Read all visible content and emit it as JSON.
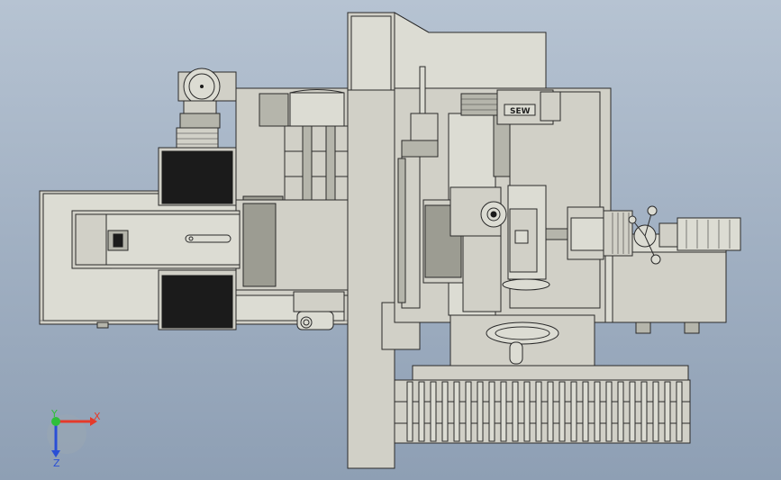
{
  "viewport": {
    "background_top": "#b6c3d2",
    "background_bottom": "#8e9fb4",
    "part_color": "#d1d0c7",
    "edge_color": "#2a2a2a"
  },
  "motor_label": "SEW",
  "triad": {
    "x_label": "X",
    "y_label": "Y",
    "z_label": "Z",
    "x_color": "#e53a2a",
    "y_color": "#2fbf3a",
    "z_color": "#2a4fd6"
  }
}
